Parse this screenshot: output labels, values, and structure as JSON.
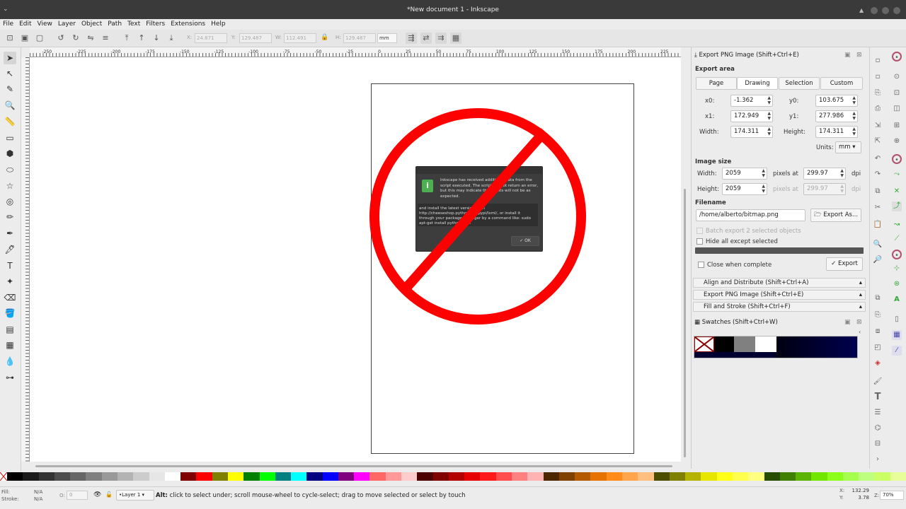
{
  "window": {
    "title": "*New document 1 - Inkscape"
  },
  "menu": [
    "File",
    "Edit",
    "View",
    "Layer",
    "Object",
    "Path",
    "Text",
    "Filters",
    "Extensions",
    "Help"
  ],
  "toolbar": {
    "x_label": "X:",
    "x_value": "24.871",
    "y_label": "Y:",
    "y_value": "129.487",
    "w_label": "W:",
    "w_value": "112.491",
    "h_label": "H:",
    "h_value": "129.487",
    "unit": "mm"
  },
  "ruler": {
    "h_ticks": [
      "-250",
      "-225",
      "-200",
      "-175",
      "-150",
      "-125",
      "-100",
      "-75",
      "-50",
      "-25",
      "0",
      "25",
      "50",
      "75",
      "100",
      "125",
      "150",
      "175",
      "200",
      "225"
    ]
  },
  "dialog": {
    "message": "Inkscape has received additional data from the script executed. The script did not return an error, but this may indicate the results will not be as expected.",
    "details": "and install the latest version from http://cheeseshop.python.org/pypi/lxml/, or install it through your package manager by a command like: sudo apt-get install python-lxml",
    "ok_label": "OK"
  },
  "export_panel": {
    "title": "Export PNG Image (Shift+Ctrl+E)",
    "export_area_label": "Export area",
    "tabs": [
      "Page",
      "Drawing",
      "Selection",
      "Custom"
    ],
    "active_tab": "Drawing",
    "x0_label": "x0:",
    "x0": "-1.362",
    "y0_label": "y0:",
    "y0": "103.675",
    "x1_label": "x1:",
    "x1": "172.949",
    "y1_label": "y1:",
    "y1": "277.986",
    "width_label": "Width:",
    "width": "174.311",
    "height_label": "Height:",
    "height": "174.311",
    "units_label": "Units:",
    "units": "mm",
    "image_size_label": "Image size",
    "img_width_label": "Width:",
    "img_width": "2059",
    "img_height_label": "Height:",
    "img_height": "2059",
    "pixels_at": "pixels at",
    "dpi1": "299.97",
    "dpi2": "299.97",
    "dpi_label": "dpi",
    "filename_label": "Filename",
    "filename": "/home/alberto/bitmap.png",
    "export_as_label": "Export As...",
    "batch_label": "Batch export 2 selected objects",
    "hide_all_label": "Hide all except selected",
    "close_when_label": "Close when complete",
    "export_label": "Export"
  },
  "collapsed_panels": [
    "Align and Distribute (Shift+Ctrl+A)",
    "Export PNG Image (Shift+Ctrl+E)",
    "Fill and Stroke (Shift+Ctrl+F)"
  ],
  "swatches": {
    "title": "Swatches (Shift+Ctrl+W)"
  },
  "palette_colors": [
    "#000000",
    "#1a1a1a",
    "#333333",
    "#4d4d4d",
    "#666666",
    "#808080",
    "#999999",
    "#b3b3b3",
    "#cccccc",
    "#e6e6e6",
    "#ffffff",
    "#800000",
    "#ff0000",
    "#808000",
    "#ffff00",
    "#008000",
    "#00ff00",
    "#008080",
    "#00ffff",
    "#000080",
    "#0000ff",
    "#800080",
    "#ff00ff",
    "#ff6666",
    "#ff9999",
    "#ffcccc",
    "#4d0000",
    "#800000",
    "#b30000",
    "#e60000",
    "#ff1a1a",
    "#ff4d4d",
    "#ff8080",
    "#ffb3b3",
    "#4d2600",
    "#804000",
    "#b35900",
    "#e67300",
    "#ff8c1a",
    "#ffa64d",
    "#ffbf80",
    "#4d4d00",
    "#808000",
    "#b3b300",
    "#e6e600",
    "#ffff1a",
    "#ffff4d",
    "#ffff80",
    "#264d00",
    "#408000",
    "#59b300",
    "#73e600",
    "#8cff1a",
    "#a6ff4d",
    "#bfff80",
    "#ccff66",
    "#e6ff99"
  ],
  "statusbar": {
    "fill_label": "Fill:",
    "fill_value": "N/A",
    "stroke_label": "Stroke:",
    "stroke_value": "N/A",
    "opacity_label": "O:",
    "opacity_value": "0",
    "layer": "•Layer 1",
    "message_bold": "Alt:",
    "message": "click to select under; scroll mouse-wheel to cycle-select; drag to move selected or select by touch",
    "x_label": "X:",
    "x_value": "132.29",
    "y_label": "Y:",
    "y_value": "3.78",
    "zoom_label": "Z:",
    "zoom_value": "70%"
  }
}
